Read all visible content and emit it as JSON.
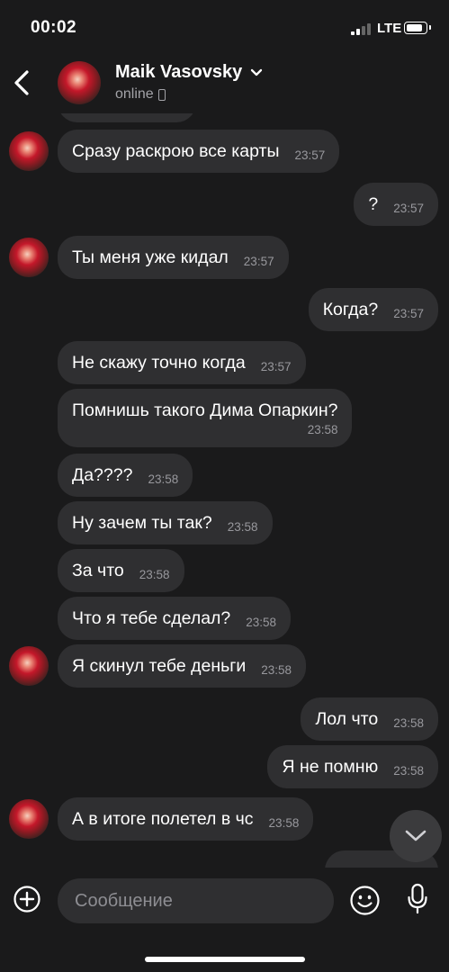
{
  "status_bar": {
    "time": "00:02",
    "network": "LTE"
  },
  "header": {
    "contact_name": "Maik Vasovsky",
    "status": "online"
  },
  "messages": [
    {
      "side": "in",
      "text": "Сразу раскрою все карты",
      "time": "23:57"
    },
    {
      "side": "out",
      "text": "?",
      "time": "23:57"
    },
    {
      "side": "in",
      "text": "Ты меня уже кидал",
      "time": "23:57"
    },
    {
      "side": "out",
      "text": "Когда?",
      "time": "23:57"
    },
    {
      "side": "in",
      "text": "Не скажу точно когда",
      "time": "23:57"
    },
    {
      "side": "in",
      "text": "Помнишь такого Дима Опаркин?",
      "time": "23:58"
    },
    {
      "side": "in",
      "text": "Да????",
      "time": "23:58"
    },
    {
      "side": "in",
      "text": "Ну зачем ты так?",
      "time": "23:58"
    },
    {
      "side": "in",
      "text": "За что",
      "time": "23:58"
    },
    {
      "side": "in",
      "text": "Что я тебе сделал?",
      "time": "23:58"
    },
    {
      "side": "in",
      "text": "Я скинул тебе деньги",
      "time": "23:58"
    },
    {
      "side": "out",
      "text": "Лол что",
      "time": "23:58"
    },
    {
      "side": "out",
      "text": "Я не помню",
      "time": "23:58"
    },
    {
      "side": "in",
      "text": "А в итоге полетел в чс",
      "time": "23:58"
    }
  ],
  "composer": {
    "placeholder": "Сообщение"
  },
  "colors": {
    "background": "#1a1a1b",
    "bubble": "#2f2f31",
    "timestamp": "#98989d"
  },
  "icons": [
    "back-arrow-icon",
    "chevron-down-icon",
    "phone-icon",
    "plus-icon",
    "emoji-icon",
    "microphone-icon",
    "scroll-down-icon"
  ]
}
